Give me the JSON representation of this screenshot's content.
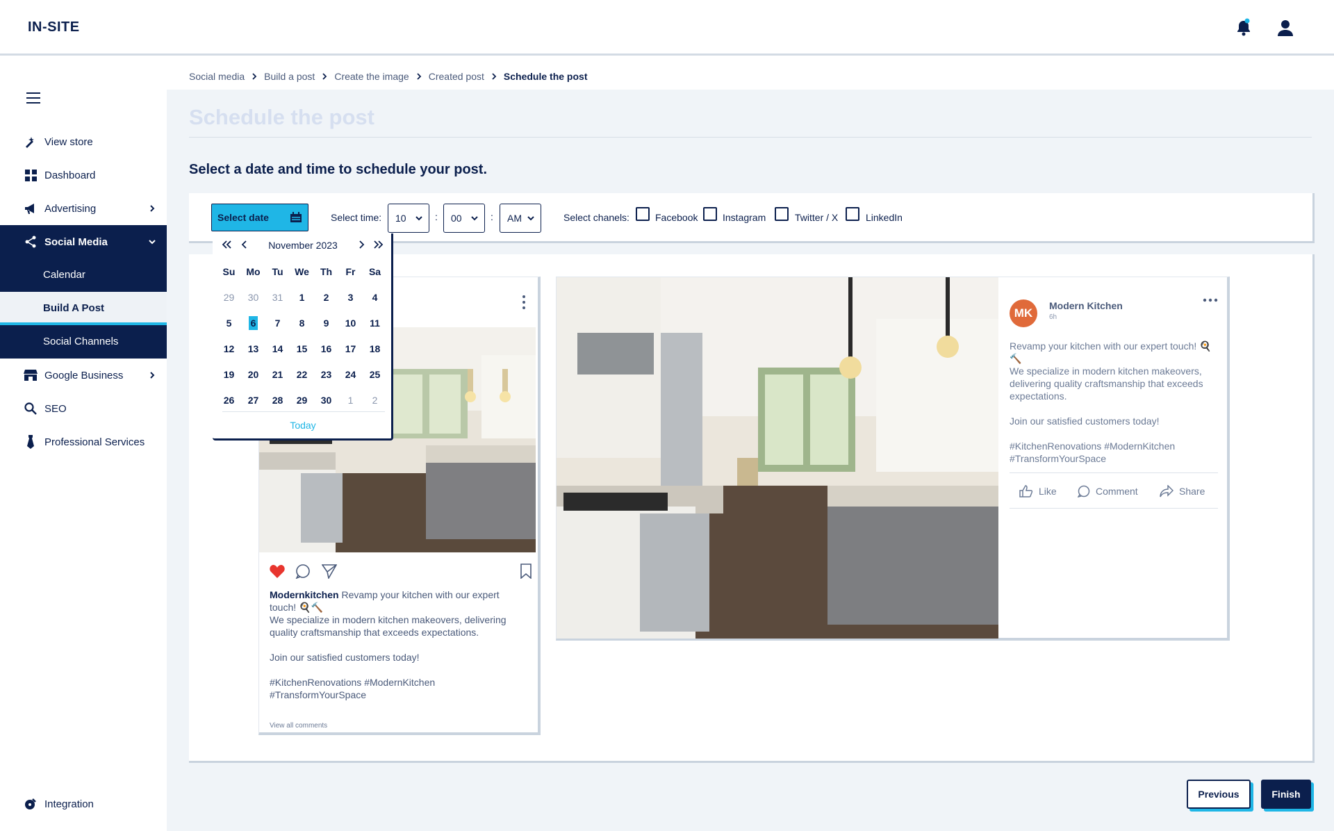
{
  "app": {
    "logo": "IN-SITE"
  },
  "header": {
    "notifications_icon": "bell-icon",
    "account_icon": "user-icon"
  },
  "sidebar": {
    "items": [
      {
        "label": "View store",
        "icon": "wand-icon"
      },
      {
        "label": "Dashboard",
        "icon": "grid-icon"
      },
      {
        "label": "Advertising",
        "icon": "megaphone-icon"
      },
      {
        "label": "Social Media",
        "icon": "share-icon"
      },
      {
        "label": "Google Business",
        "icon": "store-icon"
      },
      {
        "label": "SEO",
        "icon": "search-icon"
      },
      {
        "label": "Professional Services",
        "icon": "tie-icon"
      }
    ],
    "social_sub": [
      "Calendar",
      "Build A Post",
      "Social Channels"
    ],
    "integration": "Integration"
  },
  "breadcrumb": [
    "Social media",
    "Build a post",
    "Create the image",
    "Created post",
    "Schedule the post"
  ],
  "page": {
    "title": "Schedule the post",
    "subtitle": "Select a date and time to schedule your post."
  },
  "controls": {
    "select_date": "Select date",
    "select_time_label": "Select time:",
    "hour": "10",
    "minute": "00",
    "ampm": "AM",
    "channels_label": "Select chanels:",
    "channels": [
      "Facebook",
      "Instagram",
      "Twitter / X",
      "LinkedIn"
    ]
  },
  "calendar": {
    "month": "November 2023",
    "weekdays": [
      "Su",
      "Mo",
      "Tu",
      "We",
      "Th",
      "Fr",
      "Sa"
    ],
    "weeks": [
      [
        "29",
        "30",
        "31",
        "1",
        "2",
        "3",
        "4"
      ],
      [
        "5",
        "6",
        "7",
        "8",
        "9",
        "10",
        "11"
      ],
      [
        "12",
        "13",
        "14",
        "15",
        "16",
        "17",
        "18"
      ],
      [
        "19",
        "20",
        "21",
        "22",
        "23",
        "24",
        "25"
      ],
      [
        "26",
        "27",
        "28",
        "29",
        "30",
        "1",
        "2"
      ]
    ],
    "selected": "6",
    "today": "Today"
  },
  "instagram": {
    "username": "Modernkitchen",
    "caption_first": " Revamp your kitchen with our expert touch! 🍳🔨",
    "caption_body": "We specialize in modern kitchen makeovers, delivering quality craftsmanship that exceeds expectations.",
    "caption_join": "Join our satisfied customers today!",
    "hashtags": "#KitchenRenovations #ModernKitchen #TransformYourSpace",
    "view_comments": "View all comments"
  },
  "facebook": {
    "avatar": "MK",
    "name": "Modern Kitchen",
    "time": "6h",
    "text_first": "Revamp your kitchen with our expert touch! 🍳🔨",
    "text_body": "We specialize in modern kitchen makeovers, delivering quality craftsmanship that exceeds expectations.",
    "text_join": "Join our satisfied customers today!",
    "hashtags": "#KitchenRenovations #ModernKitchen #TransformYourSpace",
    "like": "Like",
    "comment": "Comment",
    "share": "Share"
  },
  "buttons": {
    "previous": "Previous",
    "finish": "Finish"
  },
  "colors": {
    "navy": "#0b1f4d",
    "accent": "#1fb6e6",
    "heart": "#e8352e",
    "avatar": "#e06a3a"
  }
}
